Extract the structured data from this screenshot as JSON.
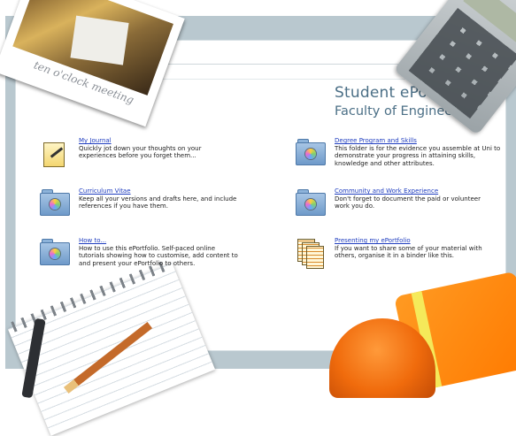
{
  "header": {
    "title": "Student ePortfolio",
    "subtitle": "Faculty of Engineering",
    "photo_caption": "ten o'clock meeting"
  },
  "items": [
    {
      "id": "my-journal",
      "link": "My Journal",
      "desc": "Quickly jot down your thoughts on your experiences before you forget them...",
      "icon": "journal-icon"
    },
    {
      "id": "degree-program",
      "link": "Degree Program and Skills",
      "desc": "This folder is for the evidence you assemble at Uni to demonstrate your progress in attaining skills, knowledge and other attributes.",
      "icon": "folder-icon"
    },
    {
      "id": "curriculum-vitae",
      "link": "Curriculum Vitae",
      "desc": "Keep all your versions and drafts here, and include references if you have them.",
      "icon": "folder-icon"
    },
    {
      "id": "community-work",
      "link": "Community and Work Experience",
      "desc": "Don't forget to document the paid or volunteer work you do.",
      "icon": "folder-icon"
    },
    {
      "id": "how-to",
      "link": "How to...",
      "desc": "How to use this ePortfolio. Self-paced online tutorials showing how to customise, add content to and present your ePortfolio to others.",
      "icon": "folder-icon"
    },
    {
      "id": "presenting",
      "link": "Presenting my ePortfolio",
      "desc": "If you want to share some of your material with others, organise it in a binder like this.",
      "icon": "documents-icon"
    }
  ]
}
